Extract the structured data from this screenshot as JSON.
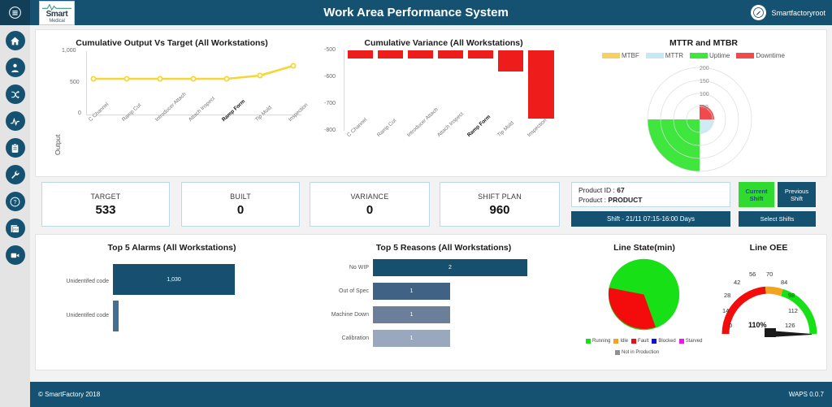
{
  "header": {
    "title": "Work Area Performance System",
    "user": "Smartfactoryroot",
    "logo_line1": "Smart",
    "logo_line2": "Medical",
    "menu_icon": "menu-icon",
    "user_icon": "edit-avatar-icon"
  },
  "sidebar": {
    "items": [
      {
        "name": "home",
        "label": "Home"
      },
      {
        "name": "operator",
        "label": "Operator"
      },
      {
        "name": "flow",
        "label": "Flow"
      },
      {
        "name": "trend",
        "label": "Trend"
      },
      {
        "name": "clipboard",
        "label": "Reports"
      },
      {
        "name": "wrench",
        "label": "Maintenance"
      },
      {
        "name": "help",
        "label": "Help"
      },
      {
        "name": "pdf",
        "label": "PDF"
      },
      {
        "name": "video",
        "label": "Video"
      }
    ]
  },
  "chart_data": [
    {
      "id": "cumulative_output",
      "type": "line",
      "title": "Cumulative Output Vs Target (All Workstations)",
      "ylabel": "Output",
      "xlabel": "",
      "categories": [
        "C Channel",
        "Ramp Cut",
        "Introducer Attach",
        "Attach Inspect",
        "Ramp Form",
        "Tip Mold",
        "Inspection"
      ],
      "highlight_category": "Ramp Form",
      "series": [
        {
          "name": "Target",
          "color": "#f5d636",
          "values": [
            533,
            533,
            533,
            533,
            533,
            577,
            753
          ]
        }
      ],
      "ylim": [
        0,
        1000
      ],
      "yticks": [
        0,
        500,
        1000
      ],
      "ytick_labels": [
        "0",
        "500",
        "1,000"
      ],
      "grid": false
    },
    {
      "id": "cumulative_variance",
      "type": "bar",
      "title": "Cumulative Variance (All Workstations)",
      "ylabel": "",
      "xlabel": "",
      "categories": [
        "C Channel",
        "Ramp Cut",
        "Introducer Attach",
        "Attach Inspect",
        "Ramp Form",
        "Tip Mold",
        "Inspection"
      ],
      "highlight_category": "Ramp Form",
      "values": [
        -533,
        -533,
        -533,
        -533,
        -533,
        -577,
        -753
      ],
      "color": "#ef1c1c",
      "ylim": [
        -800,
        -500
      ],
      "yticks": [
        -500,
        -600,
        -700,
        -800
      ],
      "ytick_labels": [
        "-500",
        "-600",
        "-700",
        "-800"
      ],
      "grid": false
    },
    {
      "id": "mttr_mtbr",
      "type": "polar",
      "title": "MTTR and MTBR",
      "rticks": [
        50,
        100,
        150,
        200
      ],
      "rtick_labels": [
        "50",
        "100",
        "150",
        "200"
      ],
      "rlim": [
        0,
        200
      ],
      "legend_position": "top",
      "series": [
        {
          "name": "MTBF",
          "color": "#f5d064",
          "value": 0
        },
        {
          "name": "MTTR",
          "color": "#c5e8f5",
          "value": 22
        },
        {
          "name": "Uptime",
          "color": "#3ee63e",
          "value": 160
        },
        {
          "name": "Downtime",
          "color": "#f2494a",
          "value": 45
        }
      ]
    },
    {
      "id": "top5_alarms",
      "type": "bar",
      "orientation": "horizontal",
      "title": "Top 5 Alarms (All Workstations)",
      "categories": [
        "Unidentifed code",
        "Unidentifed code"
      ],
      "values": [
        1030,
        30
      ],
      "value_labels": [
        "1,030",
        ""
      ],
      "colors": [
        "#16506e",
        "#456f92"
      ],
      "xlim": [
        0,
        1100
      ]
    },
    {
      "id": "top5_reasons",
      "type": "bar",
      "orientation": "horizontal",
      "title": "Top 5 Reasons (All Workstations)",
      "categories": [
        "No WIP",
        "Out of Spec",
        "Machine Down",
        "Calibration"
      ],
      "values": [
        2,
        1,
        1,
        1
      ],
      "value_labels": [
        "2",
        "1",
        "1",
        "1"
      ],
      "colors": [
        "#16506e",
        "#3f6285",
        "#6b7f9b",
        "#9aa8bd"
      ],
      "xlim": [
        0,
        2
      ]
    },
    {
      "id": "line_state",
      "type": "pie",
      "title": "Line State(min)",
      "labels": [
        "Running",
        "Idle",
        "Fault",
        "Blocked",
        "Starved",
        "Not in Production"
      ],
      "colors": [
        "#17e017",
        "#f2a41e",
        "#f40c0c",
        "#0f0fd8",
        "#f213e8",
        "#909090"
      ],
      "values": [
        78,
        0,
        22,
        0,
        0,
        0
      ]
    },
    {
      "id": "line_oee",
      "type": "gauge",
      "title": "Line OEE",
      "value": 110,
      "value_label": "110%",
      "min": 0,
      "max": 140,
      "ticks": [
        0,
        14,
        28,
        42,
        56,
        70,
        84,
        98,
        112,
        126
      ],
      "tick_labels": [
        "0",
        "14",
        "28",
        "42",
        "56",
        "70",
        "84",
        "98",
        "112",
        "126"
      ],
      "bands": [
        {
          "from": 0,
          "to": 66,
          "color": "#f40c0c"
        },
        {
          "from": 66,
          "to": 78,
          "color": "#f2a41e"
        },
        {
          "from": 78,
          "to": 140,
          "color": "#17e017"
        }
      ]
    }
  ],
  "kpis": [
    {
      "label": "TARGET",
      "value": "533"
    },
    {
      "label": "BUILT",
      "value": "0"
    },
    {
      "label": "VARIANCE",
      "value": "0"
    },
    {
      "label": "SHIFT PLAN",
      "value": "960"
    }
  ],
  "product": {
    "id_label": "Product ID :",
    "id_value": "67",
    "name_label": "Product :",
    "name_value": "PRODUCT",
    "shift_bar": "Shift - 21/11 07:15-16:00 Days"
  },
  "shift_buttons": {
    "current_l1": "Current",
    "current_l2": "Shift",
    "previous_l1": "Previous",
    "previous_l2": "Shift",
    "select": "Select Shifts"
  },
  "footer": {
    "copyright": "© SmartFactory 2018",
    "version": "WAPS 0.0.7"
  }
}
